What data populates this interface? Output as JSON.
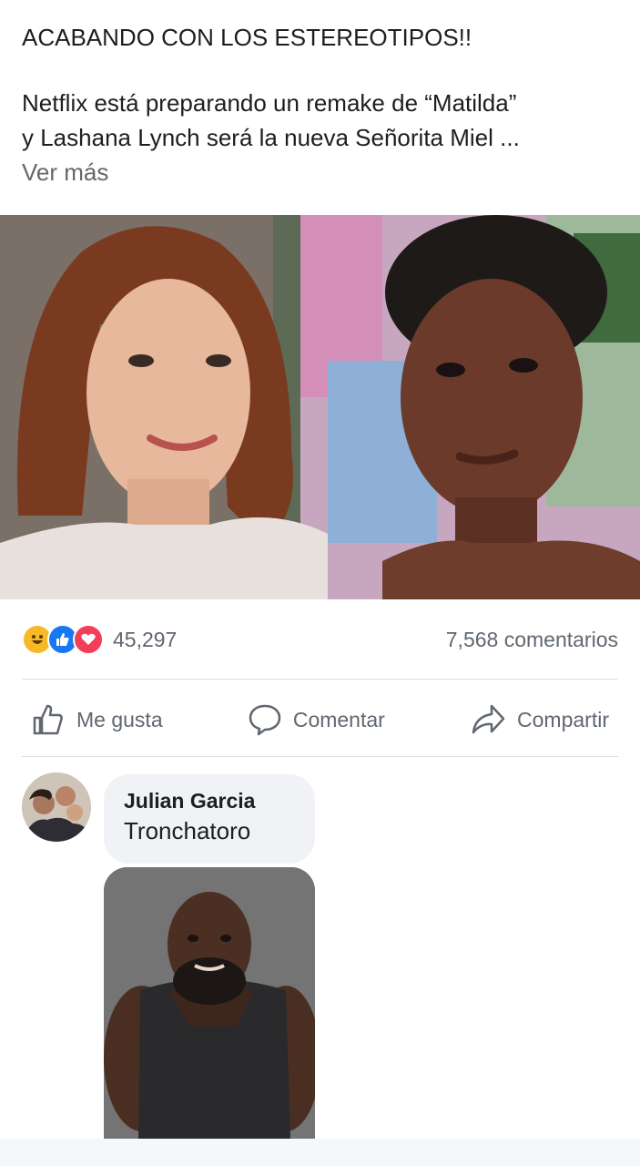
{
  "post": {
    "headline": "ACABANDO CON LOS ESTEREOTIPOS!!",
    "body_line1": "Netflix está preparando un remake de “Matilda”",
    "body_line2": "y Lashana Lynch será la nueva Señorita Miel ...",
    "see_more": "Ver más"
  },
  "stats": {
    "reaction_icons": [
      "haha-icon",
      "like-icon",
      "love-icon"
    ],
    "reaction_count": "45,297",
    "comment_count": "7,568 comentarios"
  },
  "actions": {
    "like": "Me gusta",
    "comment": "Comentar",
    "share": "Compartir"
  },
  "comment": {
    "author": "Julian Garcia",
    "text": "Tronchatoro"
  },
  "colors": {
    "text": "#1c1e21",
    "secondary": "#606770",
    "like_blue": "#1877f2",
    "love_red": "#f33e58",
    "haha_yellow": "#f7b928",
    "bubble": "#f0f2f5"
  }
}
